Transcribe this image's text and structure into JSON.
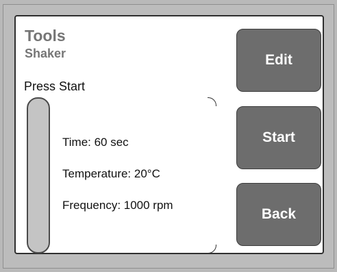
{
  "header": {
    "title": "Tools",
    "subtitle": "Shaker"
  },
  "status": {
    "text": "Press Start",
    "progress": 0
  },
  "settings": {
    "time": "Time: 60 sec",
    "temperature": "Temperature: 20°C",
    "frequency": "Frequency: 1000 rpm"
  },
  "buttons": {
    "edit": "Edit",
    "start": "Start",
    "back": "Back"
  },
  "colors": {
    "button_bg": "#6d6d6d",
    "title_gray": "#767676",
    "frame_gray": "#bcbcbc",
    "progress_track": "#c4c4c4"
  }
}
